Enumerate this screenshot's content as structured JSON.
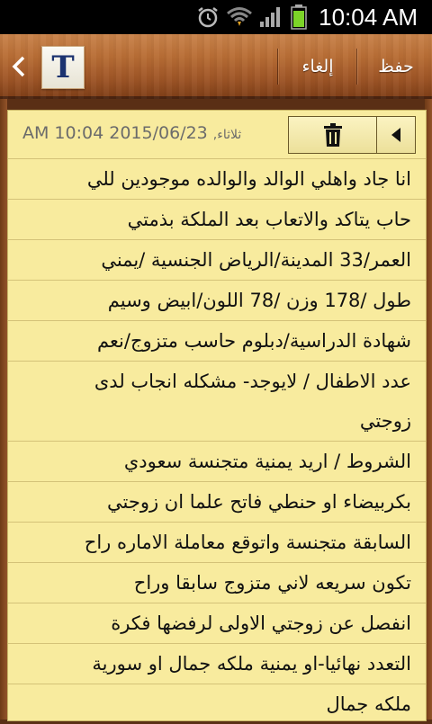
{
  "status_bar": {
    "time": "10:04 AM",
    "icons": [
      "alarm-icon",
      "wifi-icon",
      "signal-icon",
      "battery-icon"
    ]
  },
  "action_bar": {
    "save_label": "حفظ",
    "cancel_label": "إلغاء",
    "logo_letter": "T"
  },
  "note": {
    "date": "2015/06/23",
    "day": "ثلاثاء,",
    "time": "AM 10:04",
    "lines": [
      "انا جاد واهلي الوالد والوالده موجودين للي",
      "حاب يتاكد والاتعاب بعد الملكة بذمتي",
      "العمر/33 المدينة/الرياض الجنسية /يمني",
      "طول /178 وزن /78 اللون/ابيض وسيم",
      "شهادة الدراسية/دبلوم حاسب متزوج/نعم",
      "عدد الاطفال / لايوجد- مشكله انجاب لدى",
      "زوجتي",
      "الشروط / اريد يمنية متجنسة سعودي",
      "بكربيضاء او حنطي فاتح علما ان زوجتي",
      "السابقة متجنسة واتوقع معاملة الاماره راح",
      "تكون سريعه لاني متزوج سابقا وراح",
      "انفصل عن زوجتي الاولى لرفضها فكرة",
      "التعدد نهائيا-او يمنية ملكه جمال او سورية",
      "ملكه جمال"
    ]
  },
  "colors": {
    "paper": "#f8eb9e",
    "wood": "#b86d35"
  }
}
